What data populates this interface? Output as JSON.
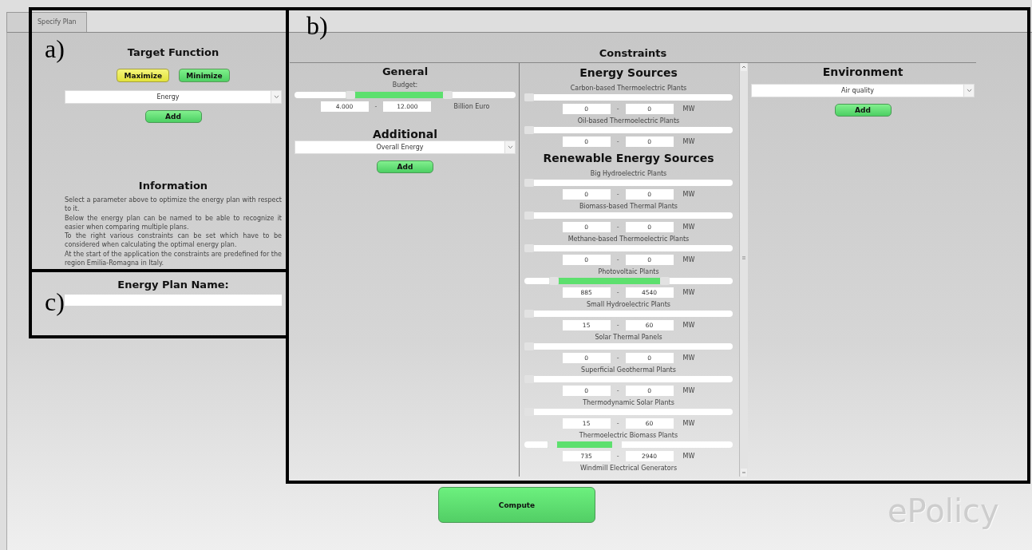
{
  "tabs": [
    {
      "label": "Specify Plan",
      "selected": true
    }
  ],
  "target_function": {
    "title": "Target Function",
    "modes": [
      {
        "label": "Maximize",
        "selected": true
      },
      {
        "label": "Minimize",
        "selected": false
      }
    ],
    "dropdown": {
      "value": "Energy"
    },
    "add_button": "Add"
  },
  "information": {
    "title": "Information",
    "paragraphs": [
      "Select a parameter above to optimize the energy plan with respect to it.",
      "Below the energy plan can be named to be able to recognize it easier when comparing multiple plans.",
      "To the right various constraints can be set which have to be considered when calculating the optimal energy plan.",
      "At the start of the application the constraints are predefined for the region Emilia-Romagna in Italy."
    ]
  },
  "plan_name": {
    "label": "Energy Plan Name:"
  },
  "constraints": {
    "title": "Constraints",
    "general": {
      "title": "General",
      "budget": {
        "label": "Budget:",
        "thumbs": [
          {
            "level": 0.23
          },
          {
            "level": 0.67
          }
        ],
        "min": "4.000",
        "separator": "-",
        "max": "12.000",
        "unit": "Billion Euro"
      },
      "additional_title": "Additional",
      "dropdown": {
        "value": "Overall Energy"
      },
      "add_button": "Add"
    },
    "energy": {
      "items": [
        {
          "kind": "heading",
          "text": "Energy Sources"
        },
        {
          "kind": "source",
          "label": "Carbon-based Thermoelectric Plants",
          "thumbs": [
            {
              "level": 0
            },
            {
              "level": 0
            }
          ],
          "min": "0",
          "separator": "-",
          "max": "0",
          "unit": "MW"
        },
        {
          "kind": "source",
          "label": "Oil-based Thermoelectric Plants",
          "thumbs": [
            {
              "level": 0
            },
            {
              "level": 0
            }
          ],
          "min": "0",
          "separator": "-",
          "max": "0",
          "unit": "MW"
        },
        {
          "kind": "heading",
          "text": "Renewable Energy Sources"
        },
        {
          "kind": "source",
          "label": "Big Hydroelectric Plants",
          "thumbs": [
            {
              "level": 0
            },
            {
              "level": 0
            }
          ],
          "min": "0",
          "separator": "-",
          "max": "0",
          "unit": "MW"
        },
        {
          "kind": "source",
          "label": "Biomass-based Thermal Plants",
          "thumbs": [
            {
              "level": 0
            },
            {
              "level": 0
            }
          ],
          "min": "0",
          "separator": "-",
          "max": "0",
          "unit": "MW"
        },
        {
          "kind": "source",
          "label": "Methane-based Thermoelectric Plants",
          "thumbs": [
            {
              "level": 0
            },
            {
              "level": 0
            }
          ],
          "min": "0",
          "separator": "-",
          "max": "0",
          "unit": "MW"
        },
        {
          "kind": "source",
          "label": "Photovoltaic Plants",
          "thumbs": [
            {
              "level": 0.12
            },
            {
              "level": 0.65
            }
          ],
          "min": "885",
          "separator": "-",
          "max": "4540",
          "unit": "MW"
        },
        {
          "kind": "source",
          "label": "Small Hydroelectric Plants",
          "thumbs": [
            {
              "level": 0
            },
            {
              "level": 0
            }
          ],
          "min": "15",
          "separator": "-",
          "max": "60",
          "unit": "MW"
        },
        {
          "kind": "source",
          "label": "Solar Thermal Panels",
          "thumbs": [
            {
              "level": 0
            },
            {
              "level": 0
            }
          ],
          "min": "0",
          "separator": "-",
          "max": "0",
          "unit": "MW"
        },
        {
          "kind": "source",
          "label": "Superficial Geothermal Plants",
          "thumbs": [
            {
              "level": 0
            },
            {
              "level": 0
            }
          ],
          "min": "0",
          "separator": "-",
          "max": "0",
          "unit": "MW"
        },
        {
          "kind": "source",
          "label": "Thermodynamic Solar Plants",
          "thumbs": [
            {
              "level": 0
            },
            {
              "level": 0
            }
          ],
          "min": "15",
          "separator": "-",
          "max": "60",
          "unit": "MW"
        },
        {
          "kind": "source",
          "label": "Thermoelectric Biomass Plants",
          "thumbs": [
            {
              "level": 0.11
            },
            {
              "level": 0.42
            }
          ],
          "min": "735",
          "separator": "-",
          "max": "2940",
          "unit": "MW"
        },
        {
          "kind": "source",
          "label": "Windmill Electrical Generators"
        }
      ]
    },
    "environment": {
      "title": "Environment",
      "dropdown": {
        "value": "Air quality"
      },
      "add_button": "Add"
    }
  },
  "compute_button": "Compute",
  "logo": "ePolicy",
  "annotations": [
    {
      "label": "a)"
    },
    {
      "label": "b)"
    },
    {
      "label": "c)"
    }
  ]
}
